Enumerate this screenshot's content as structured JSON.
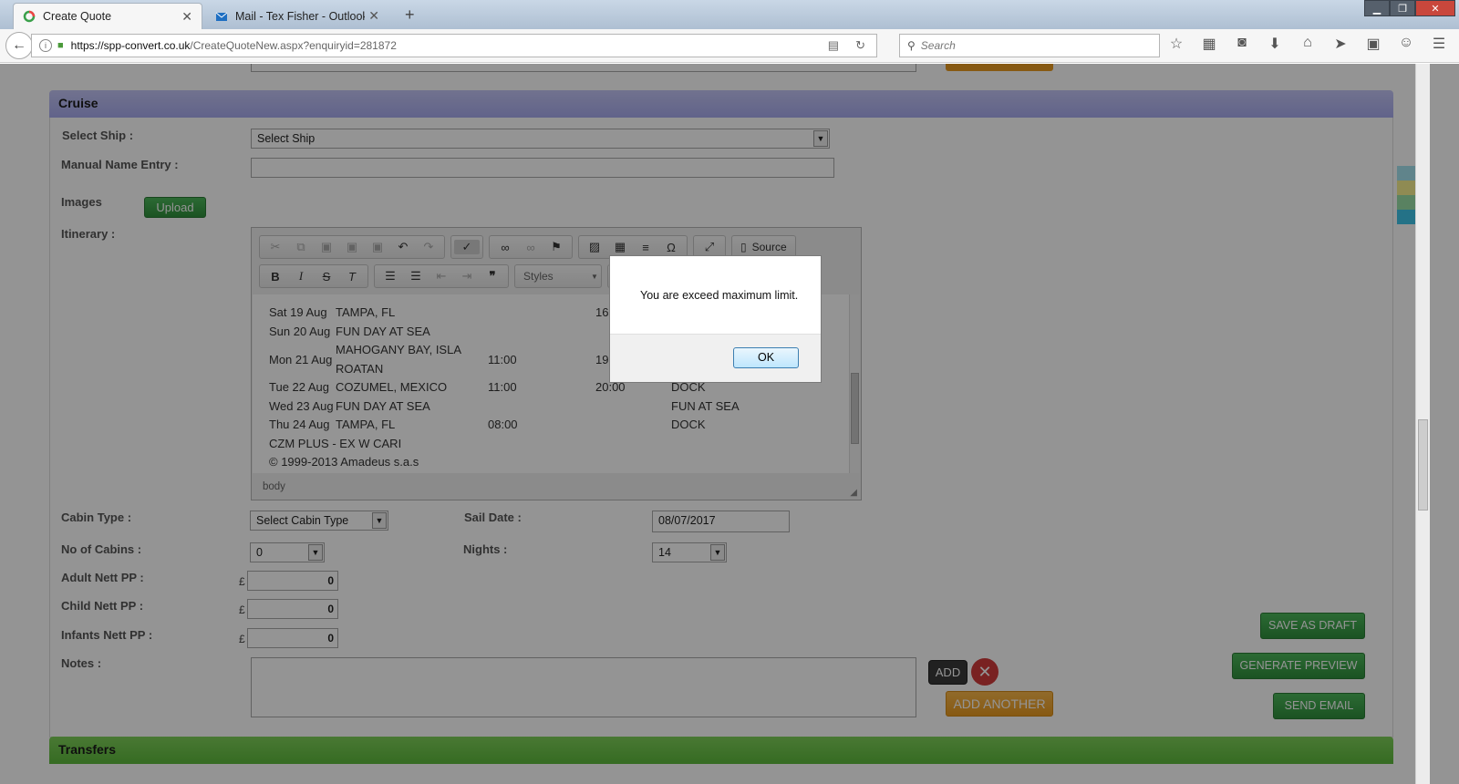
{
  "browser": {
    "tabs": [
      {
        "title": "Create Quote",
        "active": true
      },
      {
        "title": "Mail - Tex Fisher - Outlook",
        "active": false
      }
    ],
    "url_host": "https://spp-convert.co.uk",
    "url_path": "/CreateQuoteNew.aspx?enquiryid=281872",
    "search_placeholder": "Search"
  },
  "cruise": {
    "section_title": "Cruise",
    "select_ship_label": "Select Ship :",
    "select_ship_value": "Select Ship",
    "manual_name_label": "Manual Name Entry :",
    "images_label": "Images",
    "upload_label": "Upload",
    "itinerary_label": "Itinerary :",
    "editor": {
      "source_label": "Source",
      "styles_label": "Styles",
      "footer_path": "body",
      "rows": [
        {
          "day": "Sat 19 Aug",
          "port": "TAMPA, FL",
          "arrive": "",
          "depart": "16",
          "type": ""
        },
        {
          "day": "Sun 20 Aug",
          "port": "FUN DAY AT SEA",
          "arrive": "",
          "depart": "",
          "type": ""
        },
        {
          "day": "Mon 21 Aug",
          "port": "MAHOGANY BAY, ISLA",
          "port2": "ROATAN",
          "arrive": "11:00",
          "depart": "19",
          "type": ""
        },
        {
          "day": "Tue 22 Aug",
          "port": "COZUMEL, MEXICO",
          "arrive": "11:00",
          "depart": "20:00",
          "type": "DOCK"
        },
        {
          "day": "Wed 23 Aug",
          "port": "FUN DAY AT SEA",
          "arrive": "",
          "depart": "",
          "type": "FUN AT SEA"
        },
        {
          "day": "Thu 24 Aug",
          "port": "TAMPA, FL",
          "arrive": "08:00",
          "depart": "",
          "type": "DOCK"
        }
      ],
      "note1": "CZM PLUS - EX W CARI",
      "note2": "© 1999-2013 Amadeus s.a.s"
    },
    "cabin_type_label": "Cabin Type :",
    "cabin_type_value": "Select Cabin Type",
    "sail_date_label": "Sail Date :",
    "sail_date_value": "08/07/2017",
    "no_cabins_label": "No of Cabins :",
    "no_cabins_value": "0",
    "nights_label": "Nights :",
    "nights_value": "14",
    "adult_label": "Adult Nett PP :",
    "adult_value": "0",
    "child_label": "Child Nett PP :",
    "child_value": "0",
    "infant_label": "Infants Nett PP :",
    "infant_value": "0",
    "currency_symbol": "£",
    "notes_label": "Notes :",
    "add_label": "ADD",
    "add_another_label": "ADD ANOTHER",
    "save_draft_label": "SAVE AS DRAFT",
    "generate_preview_label": "GENERATE PREVIEW",
    "send_email_label": "SEND EMAIL"
  },
  "transfers": {
    "section_title": "Transfers"
  },
  "dialog": {
    "message": "You are exceed maximum limit.",
    "ok_label": "OK"
  },
  "colors": {
    "cruise_header": "#a8abee",
    "transfers_header": "#5cb93c",
    "button_green": "#2f8f3c",
    "button_orange": "#e99a20"
  }
}
